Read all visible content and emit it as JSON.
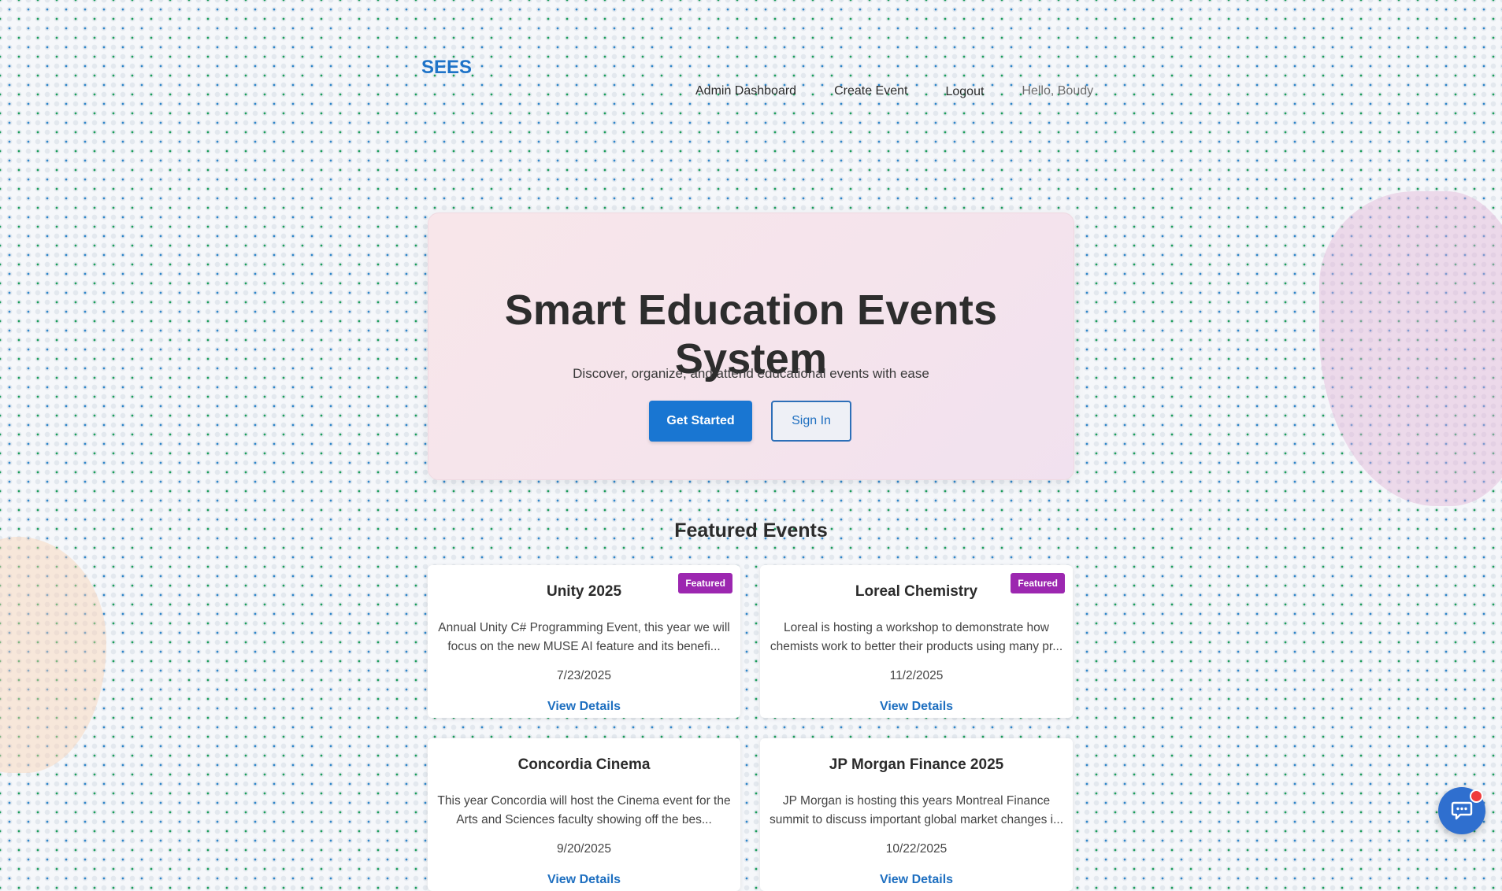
{
  "header": {
    "logo": "SEES",
    "nav": {
      "admin_dashboard": "Admin Dashboard",
      "create_event": "Create Event",
      "logout": "Logout",
      "greeting": "Hello, Boudy"
    }
  },
  "hero": {
    "title": "Smart Education Events System",
    "tagline": "Discover, organize, and attend educational events with ease",
    "primary_button": "Get Started",
    "secondary_button": "Sign In"
  },
  "featured": {
    "title": "Featured Events",
    "badge_label": "Featured",
    "link_label": "View Details",
    "events": [
      {
        "title": "Unity 2025",
        "description": "Annual Unity C# Programming Event, this year we will focus on the new MUSE AI feature and its benefi...",
        "date": "7/23/2025",
        "featured": true
      },
      {
        "title": "Loreal Chemistry",
        "description": "Loreal is hosting a workshop to demonstrate how chemists work to better their products using many pr...",
        "date": "11/2/2025",
        "featured": true
      },
      {
        "title": "Concordia Cinema",
        "description": "This year Concordia will host the Cinema event for the Arts and Sciences faculty showing off the bes...",
        "date": "9/20/2025",
        "featured": false
      },
      {
        "title": "JP Morgan Finance 2025",
        "description": "JP Morgan is hosting this years Montreal Finance summit to discuss important global market changes i...",
        "date": "10/22/2025",
        "featured": false
      }
    ]
  },
  "colors": {
    "accent": "#1976d2",
    "badge": "#9c27b0",
    "chat_button": "#2f6fcf",
    "notification_dot": "#ef3b3b"
  },
  "icons": {
    "chat": "chat-bubble-icon"
  }
}
